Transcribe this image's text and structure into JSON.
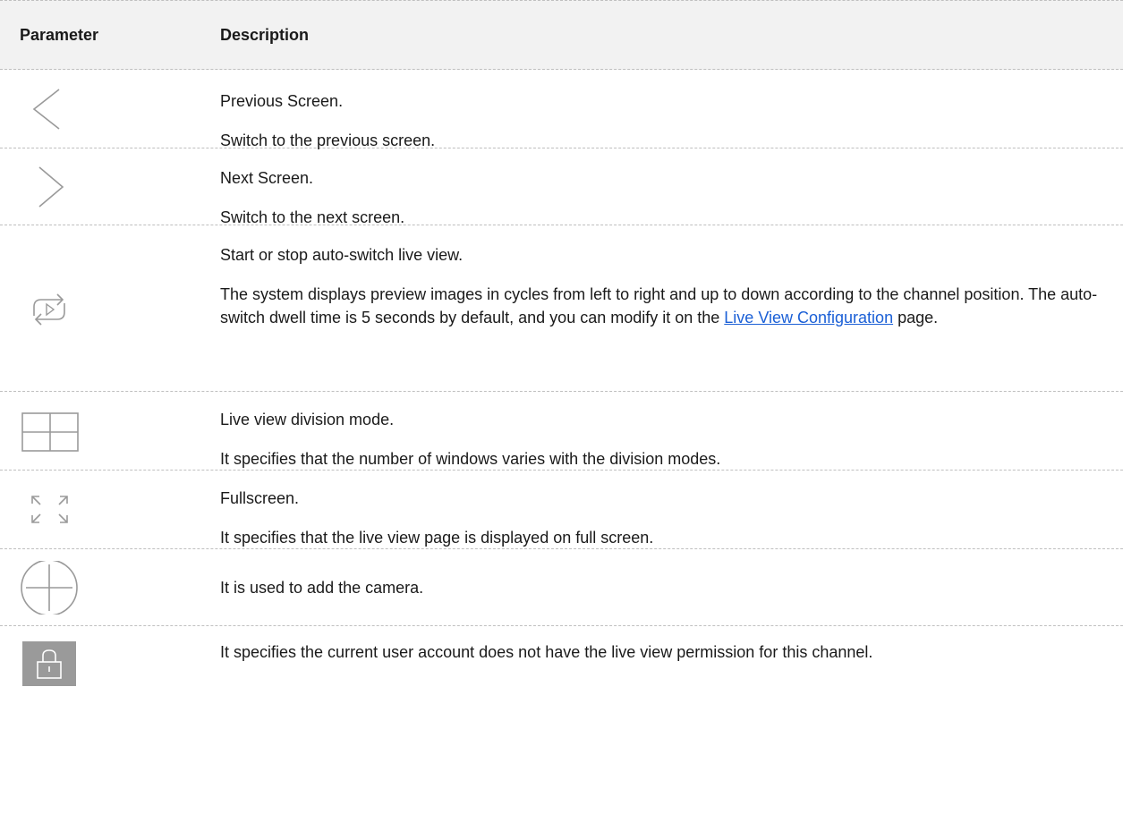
{
  "table": {
    "headers": {
      "parameter": "Parameter",
      "description": "Description"
    },
    "rows": [
      {
        "icon": "chevron-left-icon",
        "title": "Previous Screen.",
        "detail": "Switch to the previous screen."
      },
      {
        "icon": "chevron-right-icon",
        "title": "Next Screen.",
        "detail": "Switch to the next screen."
      },
      {
        "icon": "auto-switch-icon",
        "title": "Start or stop auto-switch live view.",
        "detail_prefix": "The system displays preview images in cycles from left to right and up to down according to the channel position. The auto-switch dwell time is 5 seconds by default, and you can modify it on the ",
        "detail_link": "Live View Configuration",
        "detail_suffix": " page."
      },
      {
        "icon": "grid-division-icon",
        "title": "Live view division mode.",
        "detail": "It specifies that the number of windows varies with the division modes."
      },
      {
        "icon": "fullscreen-icon",
        "title": "Fullscreen.",
        "detail": "It specifies that the live view page is displayed on full screen."
      },
      {
        "icon": "add-camera-icon",
        "detail": "It is used to add the camera."
      },
      {
        "icon": "lock-icon",
        "detail": "It specifies the current user account does not have the live view permission for this channel."
      }
    ]
  },
  "colors": {
    "header_bg": "#f2f2f2",
    "border": "#bfbfbf",
    "link": "#1a5fd6",
    "icon": "#9a9a9a"
  }
}
